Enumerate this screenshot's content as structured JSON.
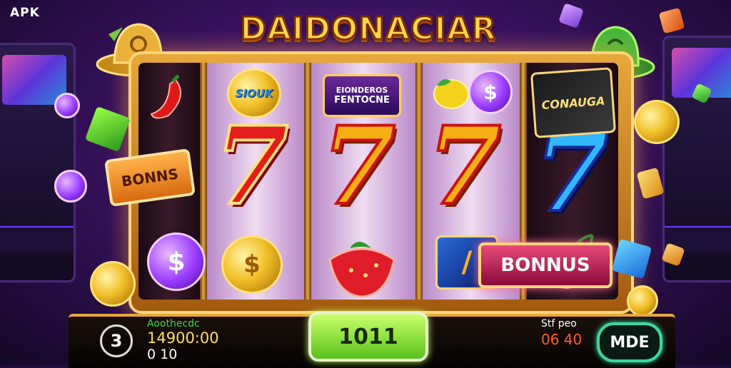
{
  "badge": "APK",
  "title": "DAIDONACIAR",
  "reels": {
    "top_labels": [
      "SIOUK",
      "FENTOCNE",
      "CONAUGA"
    ],
    "ribbon_text": "EIONDEROS",
    "coin_symbol": "$"
  },
  "bonus_left": "BONNS",
  "bonus_right": "BONNUS",
  "bottom_bar": {
    "level": "3",
    "credit_label": "Aoothecdc",
    "credit_value": "14900:00",
    "credit_sub": "0 10",
    "spin_label": "1011",
    "stake_label": "Stf peo",
    "stake_value": "06 40",
    "mode_label": "MDE"
  },
  "colors": {
    "title": "#ffd84a",
    "frame": "#e8a83a",
    "spin": "#7ad82a",
    "mode_ring": "#3ad8a0"
  },
  "icons": [
    "gold-hat-icon",
    "green-hat-icon",
    "chili-icon",
    "cherry-icon",
    "strawberry-icon",
    "coin-icon",
    "dollar-coin-icon",
    "cube-icon"
  ]
}
